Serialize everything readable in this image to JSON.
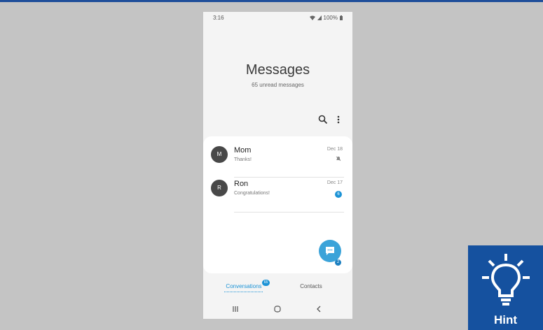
{
  "status_bar": {
    "time": "3:16",
    "battery": "100%"
  },
  "header": {
    "title": "Messages",
    "subtitle": "65 unread messages"
  },
  "toolbar": {
    "search_icon": "search-icon",
    "more_icon": "more-vert-icon"
  },
  "conversations": [
    {
      "initial": "M",
      "name": "Mom",
      "preview": "Thanks!",
      "date": "Dec 18",
      "indicator": "mute-icon"
    },
    {
      "initial": "R",
      "name": "Ron",
      "preview": "Congratulations!",
      "date": "Dec 17",
      "unread": "6"
    }
  ],
  "fab": {
    "icon": "compose-message-icon",
    "badge": "2"
  },
  "tabs": [
    {
      "label": "Conversations",
      "badge": "65",
      "active": true
    },
    {
      "label": "Contacts"
    }
  ],
  "nav_bar": {
    "icons": [
      "recents-icon",
      "home-icon",
      "back-icon"
    ]
  },
  "hint": {
    "label": "Hint",
    "icon": "lightbulb-icon"
  },
  "colors": {
    "accent": "#1c93d6",
    "fab": "#3ba3d9",
    "hint_bg": "#15519f",
    "backdrop": "#c4c4c4"
  }
}
